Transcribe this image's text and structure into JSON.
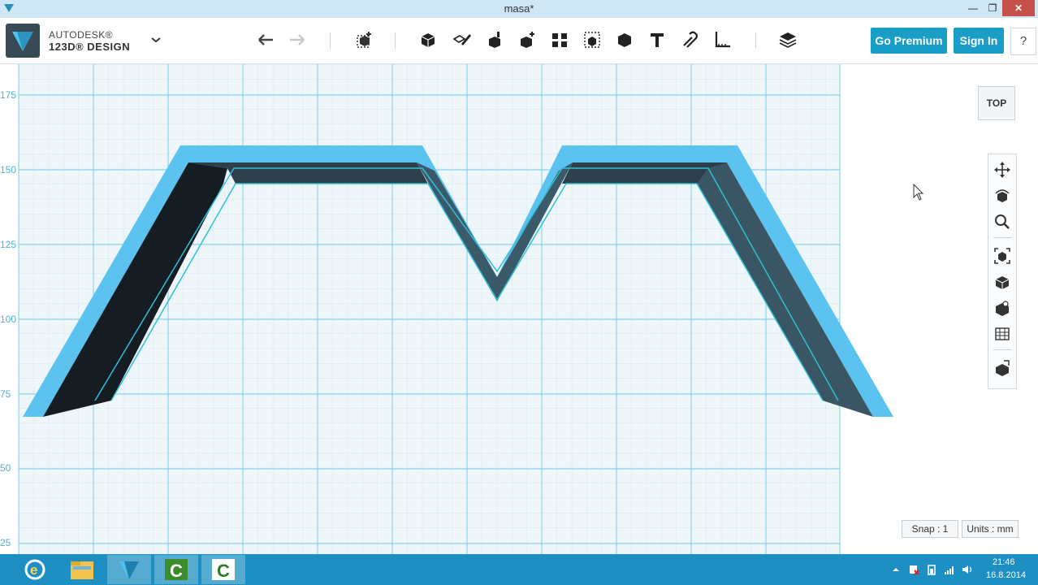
{
  "window": {
    "title": "masa*",
    "minimize_symbol": "—",
    "restore_symbol": "❐",
    "close_symbol": "✕"
  },
  "app": {
    "brand_line1": "AUTODESK®",
    "brand_line2": "123D® DESIGN",
    "accent_color": "#1a9dc7"
  },
  "toolbar": {
    "icons": [
      "undo-icon",
      "redo-icon",
      "transform-icon",
      "primitives-icon",
      "sketch-icon",
      "construct-icon",
      "modify-icon",
      "pattern-icon",
      "grouping-icon",
      "combine-icon",
      "text-icon",
      "snap-icon",
      "measure-icon",
      "materials-icon"
    ],
    "go_premium_label": "Go Premium",
    "sign_in_label": "Sign In",
    "help_label": "?"
  },
  "viewport": {
    "y_axis_labels": [
      "175",
      "150",
      "125",
      "100",
      "75",
      "50",
      "25"
    ],
    "view_cube_label": "TOP",
    "nav_icons": [
      "pan-icon",
      "orbit-icon",
      "zoom-icon",
      "fit-icon",
      "perspective-icon",
      "visibility-icon",
      "materials-view-icon",
      "grid-icon"
    ],
    "snap_label": "Snap : 1",
    "units_label": "Units : mm"
  },
  "taskbar": {
    "apps": [
      "internet-explorer-icon",
      "file-explorer-icon",
      "123d-design-icon",
      "camtasia-recorder-icon",
      "camtasia-studio-icon"
    ],
    "clock_time": "21:46",
    "clock_date": "16.8.2014"
  }
}
